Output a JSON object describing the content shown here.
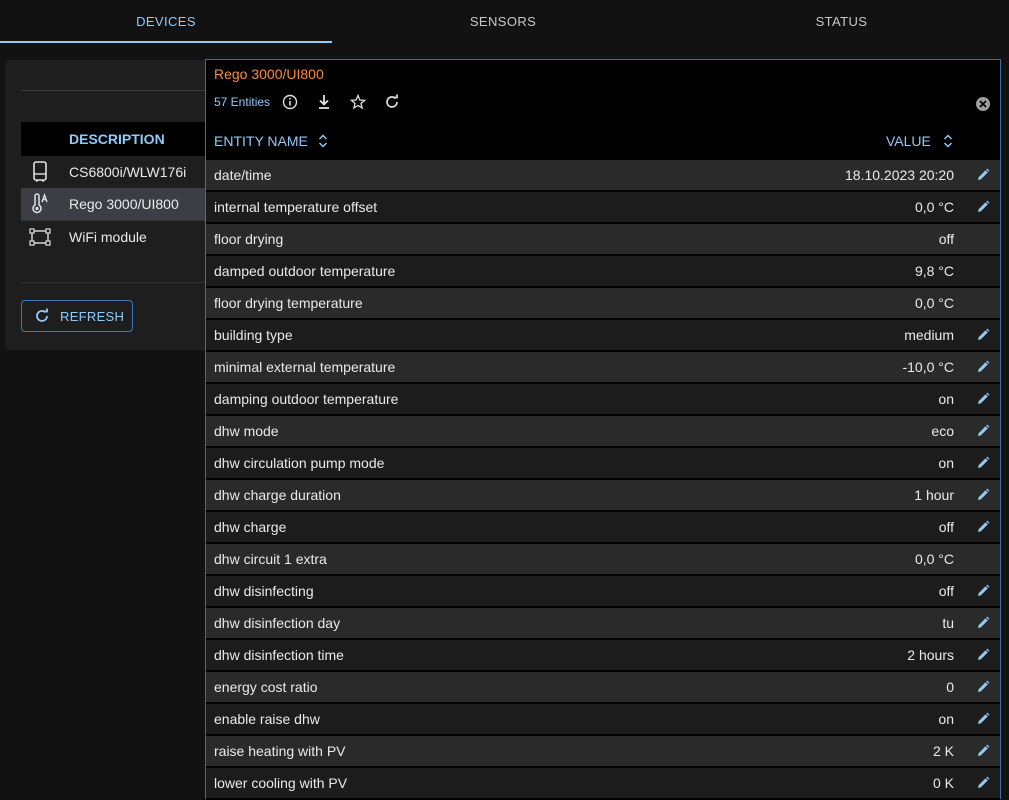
{
  "tabs": [
    {
      "label": "DEVICES",
      "active": true
    },
    {
      "label": "SENSORS",
      "active": false
    },
    {
      "label": "STATUS",
      "active": false
    }
  ],
  "device_panel": {
    "column_header": "DESCRIPTION",
    "devices": [
      {
        "label": "CS6800i/WLW176i",
        "icon": "heat-pump-icon",
        "selected": false
      },
      {
        "label": "Rego 3000/UI800",
        "icon": "thermostat-icon",
        "selected": true
      },
      {
        "label": "WiFi module",
        "icon": "module-icon",
        "selected": false
      }
    ],
    "refresh_label": "REFRESH"
  },
  "dialog": {
    "title": "Rego 3000/UI800",
    "entity_count": "57 Entities",
    "col_name": "ENTITY NAME",
    "col_value": "VALUE",
    "rows": [
      {
        "name": "date/time",
        "value": "18.10.2023 20:20",
        "editable": true
      },
      {
        "name": "internal temperature offset",
        "value": "0,0 °C",
        "editable": true
      },
      {
        "name": "floor drying",
        "value": "off",
        "editable": false
      },
      {
        "name": "damped outdoor temperature",
        "value": "9,8 °C",
        "editable": false
      },
      {
        "name": "floor drying temperature",
        "value": "0,0 °C",
        "editable": false
      },
      {
        "name": "building type",
        "value": "medium",
        "editable": true
      },
      {
        "name": "minimal external temperature",
        "value": "-10,0 °C",
        "editable": true
      },
      {
        "name": "damping outdoor temperature",
        "value": "on",
        "editable": true
      },
      {
        "name": "dhw mode",
        "value": "eco",
        "editable": true
      },
      {
        "name": "dhw circulation pump mode",
        "value": "on",
        "editable": true
      },
      {
        "name": "dhw charge duration",
        "value": "1 hour",
        "editable": true
      },
      {
        "name": "dhw charge",
        "value": "off",
        "editable": true
      },
      {
        "name": "dhw circuit 1 extra",
        "value": "0,0 °C",
        "editable": false
      },
      {
        "name": "dhw disinfecting",
        "value": "off",
        "editable": true
      },
      {
        "name": "dhw disinfection day",
        "value": "tu",
        "editable": true
      },
      {
        "name": "dhw disinfection time",
        "value": "2 hours",
        "editable": true
      },
      {
        "name": "energy cost ratio",
        "value": "0",
        "editable": true
      },
      {
        "name": "enable raise dhw",
        "value": "on",
        "editable": true
      },
      {
        "name": "raise heating with PV",
        "value": "2 K",
        "editable": true
      },
      {
        "name": "lower cooling with PV",
        "value": "0 K",
        "editable": true
      }
    ]
  },
  "colors": {
    "accent": "#90caf9",
    "title": "#ff8c32",
    "border": "#3b6ea5"
  }
}
